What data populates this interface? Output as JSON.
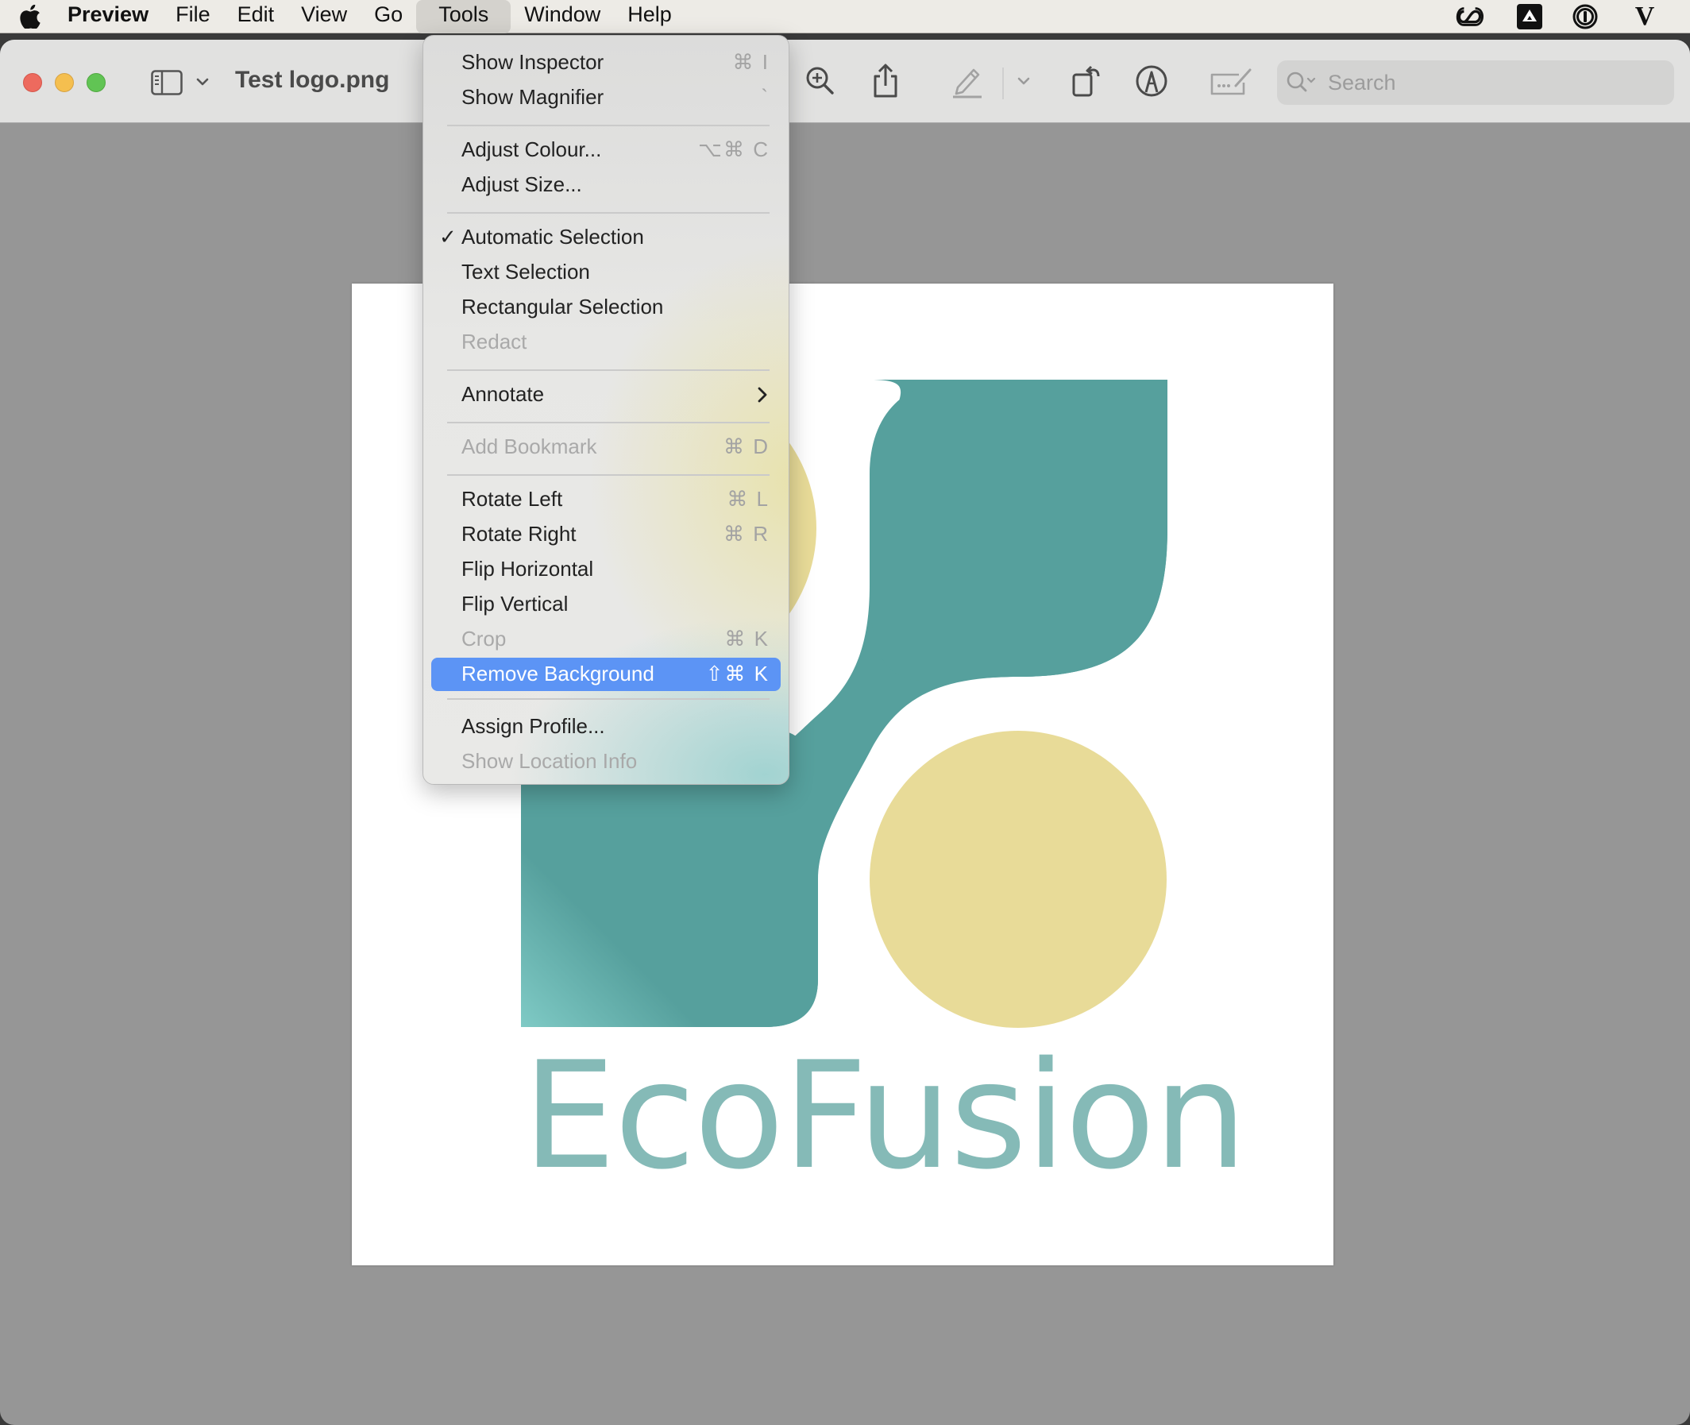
{
  "menubar": {
    "apple_icon": "apple-logo-icon",
    "app_name": "Preview",
    "items": [
      "File",
      "Edit",
      "View",
      "Go",
      "Tools",
      "Window",
      "Help"
    ],
    "active_item": "Tools",
    "status_icons": [
      "creative-cloud-icon",
      "google-drive-icon",
      "1password-icon",
      "v-app-icon"
    ],
    "v_glyph": "V"
  },
  "window": {
    "title": "Test logo.png",
    "toolbar": {
      "sidebar_toggle": "sidebar-icon",
      "icons": [
        "zoom-in-icon",
        "share-icon",
        "highlight-pen-icon",
        "highlight-options-chevron-icon",
        "rotate-icon",
        "markup-icon",
        "form-fill-icon"
      ],
      "search": {
        "placeholder": "Search",
        "value": ""
      }
    }
  },
  "document": {
    "brand_text": "EcoFusion",
    "colors": {
      "teal": "#56a09d",
      "yellow": "#e8db98",
      "text": "#85bab7"
    }
  },
  "tools_menu": {
    "groups": [
      [
        {
          "label": "Show Inspector",
          "shortcut": "⌘ I",
          "enabled": true
        },
        {
          "label": "Show Magnifier",
          "shortcut": "`",
          "enabled": true
        }
      ],
      [
        {
          "label": "Adjust Colour...",
          "shortcut": "⌥⌘ C",
          "enabled": true
        },
        {
          "label": "Adjust Size...",
          "shortcut": "",
          "enabled": true
        }
      ],
      [
        {
          "label": "Automatic Selection",
          "shortcut": "",
          "enabled": true,
          "checked": true
        },
        {
          "label": "Text Selection",
          "shortcut": "",
          "enabled": true
        },
        {
          "label": "Rectangular Selection",
          "shortcut": "",
          "enabled": true
        },
        {
          "label": "Redact",
          "shortcut": "",
          "enabled": false
        }
      ],
      [
        {
          "label": "Annotate",
          "shortcut": "",
          "enabled": true,
          "submenu": true
        }
      ],
      [
        {
          "label": "Add Bookmark",
          "shortcut": "⌘ D",
          "enabled": false
        }
      ],
      [
        {
          "label": "Rotate Left",
          "shortcut": "⌘ L",
          "enabled": true
        },
        {
          "label": "Rotate Right",
          "shortcut": "⌘ R",
          "enabled": true
        },
        {
          "label": "Flip Horizontal",
          "shortcut": "",
          "enabled": true
        },
        {
          "label": "Flip Vertical",
          "shortcut": "",
          "enabled": true
        },
        {
          "label": "Crop",
          "shortcut": "⌘ K",
          "enabled": false
        },
        {
          "label": "Remove Background",
          "shortcut": "⇧⌘ K",
          "enabled": true,
          "highlighted": true
        }
      ],
      [
        {
          "label": "Assign Profile...",
          "shortcut": "",
          "enabled": true
        },
        {
          "label": "Show Location Info",
          "shortcut": "",
          "enabled": false
        }
      ]
    ],
    "check_glyph": "✓",
    "highlight_color": "#5c94f5"
  }
}
